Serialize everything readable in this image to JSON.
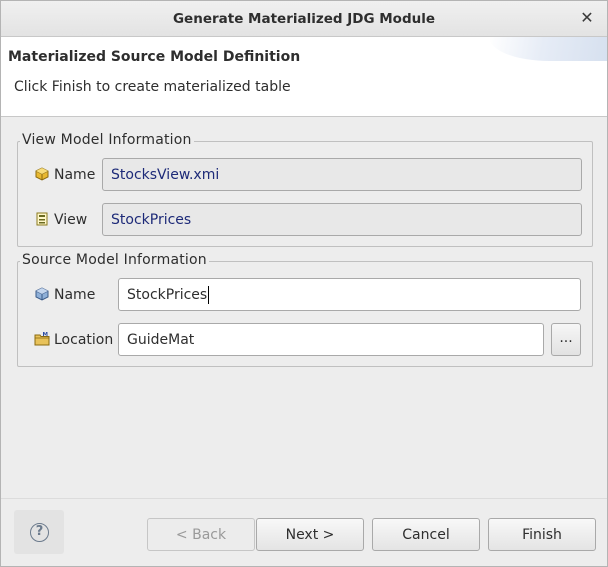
{
  "window": {
    "title": "Generate Materialized JDG Module",
    "close_glyph": "✕"
  },
  "header": {
    "heading": "Materialized Source Model Definition",
    "description": "Click Finish to create materialized table"
  },
  "view_model": {
    "legend": "View Model Information",
    "name_label": "Name",
    "name_value": "StocksView.xmi",
    "name_icon": "model-icon",
    "view_label": "View",
    "view_value": "StockPrices",
    "view_icon": "table-view-icon"
  },
  "source_model": {
    "legend": "Source Model Information",
    "name_label": "Name",
    "name_value": "StockPrices",
    "name_icon": "source-model-icon",
    "location_label": "Location",
    "location_value": "GuideMat",
    "location_icon": "project-folder-icon",
    "browse_label": "..."
  },
  "footer": {
    "help_glyph": "?",
    "back_label": "< Back",
    "next_label": "Next >",
    "cancel_label": "Cancel",
    "finish_label": "Finish"
  },
  "colors": {
    "readonly_text": "#1d2a78",
    "dialog_bg": "#ededed",
    "header_bg": "#ffffff"
  }
}
